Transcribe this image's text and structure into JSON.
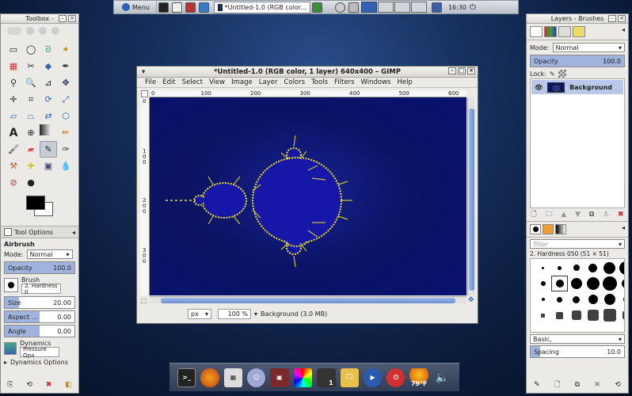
{
  "topbar": {
    "menu_label": "Menu",
    "task_title": "*Untitled-1.0 (RGB color...",
    "clock": "16:30",
    "workspaces": 4,
    "active_workspace": 1
  },
  "toolbox": {
    "title": "Toolbox - ",
    "tool_options_tab": "Tool Options",
    "tool_name": "Airbrush",
    "mode_label": "Mode:",
    "mode_value": "Normal",
    "opacity_label": "Opacity",
    "opacity_value": "100.0",
    "brush_label": "Brush",
    "brush_value": "2. Hardness 0",
    "size_label": "Size",
    "size_value": "20.00",
    "aspect_label": "Aspect ...",
    "aspect_value": "0.00",
    "angle_label": "Angle",
    "angle_value": "0.00",
    "dynamics_label": "Dynamics",
    "dynamics_value": "Pressure Opa",
    "dynamics_options": "Dynamics Options"
  },
  "image_window": {
    "title": "*Untitled-1.0 (RGB color, 1 layer) 640x400 – GIMP",
    "menus": [
      "File",
      "Edit",
      "Select",
      "View",
      "Image",
      "Layer",
      "Colors",
      "Tools",
      "Filters",
      "Windows",
      "Help"
    ],
    "ruler_ticks": [
      "0",
      "100",
      "200",
      "300",
      "400",
      "500",
      "600"
    ],
    "vruler_ticks": [
      "0",
      "1\n0\n0",
      "2\n0\n0",
      "3\n0\n0"
    ],
    "unit": "px",
    "zoom": "100 %",
    "status": "Background (3.0 MB)"
  },
  "layers": {
    "title": "Layers - Brushes",
    "mode_label": "Mode:",
    "mode_value": "Normal",
    "opacity_label": "Opacity",
    "opacity_value": "100.0",
    "lock_label": "Lock:",
    "layer_name": "Background",
    "filter_placeholder": "filter",
    "brush_name": "2. Hardness 050 (51 × 51)",
    "brush_set": "Basic,",
    "spacing_label": "Spacing",
    "spacing_value": "10.0"
  },
  "dock": {
    "workspace_num": "1",
    "weather": "79°F"
  },
  "colors": {
    "accent": "#9fb3dd",
    "selection": "#b9c8e8",
    "fractal_edge": "#e8e020"
  }
}
